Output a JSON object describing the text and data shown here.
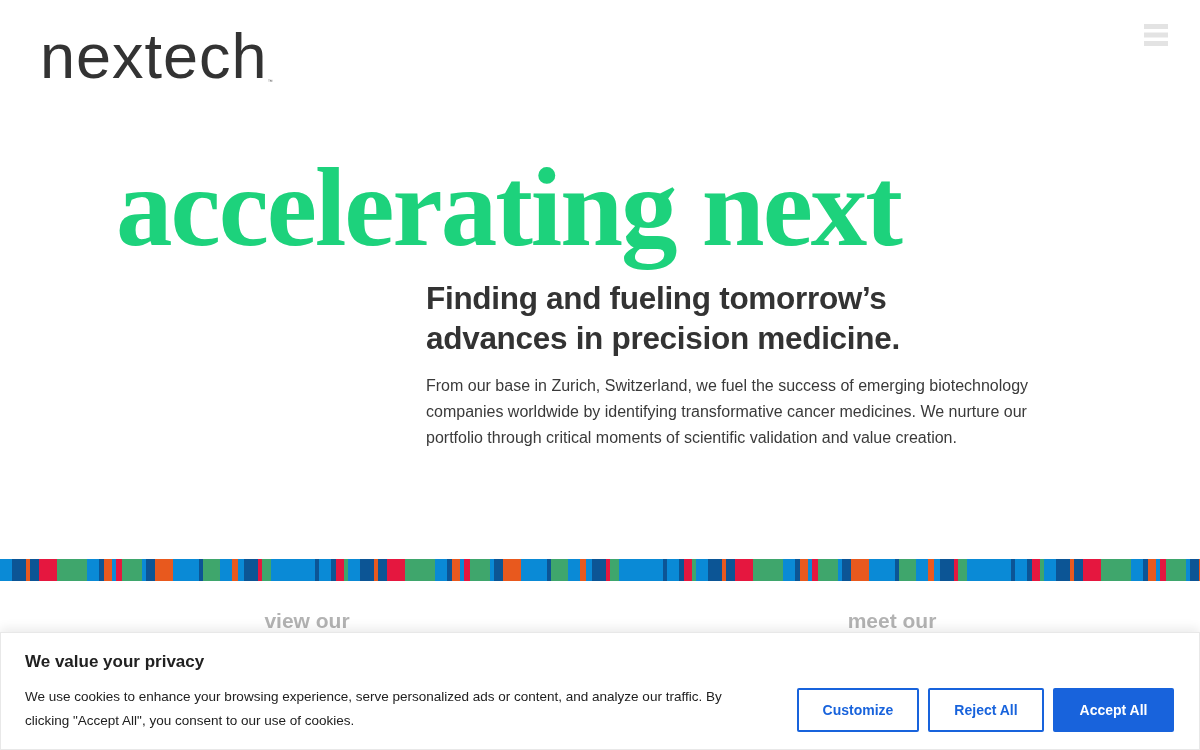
{
  "header": {
    "logo": {
      "text": "nextech",
      "mark": "™"
    }
  },
  "hero": {
    "headline": "accelerating next",
    "subheading": [
      "Finding and fueling tomorrow’s",
      "advances in precision medicine."
    ],
    "paragraph": "From our base in Zurich, Switzerland, we fuel the success of emerging biotechnology companies worldwide by identifying transformative cancer medicines. We nurture our portfolio through critical moments of scientific validation and value creation."
  },
  "sections": [
    {
      "label": "view our"
    },
    {
      "label": "meet our"
    }
  ],
  "cookie_banner": {
    "title": "We value your privacy",
    "text": "We use cookies to enhance your browsing experience, serve personalized ads or content, and analyze our traffic. By clicking \"Accept All\", you consent to our use of cookies.",
    "buttons": [
      {
        "label": "Customize",
        "kind": "outline"
      },
      {
        "label": "Reject All",
        "kind": "outline"
      },
      {
        "label": "Accept All",
        "kind": "primary"
      }
    ]
  }
}
